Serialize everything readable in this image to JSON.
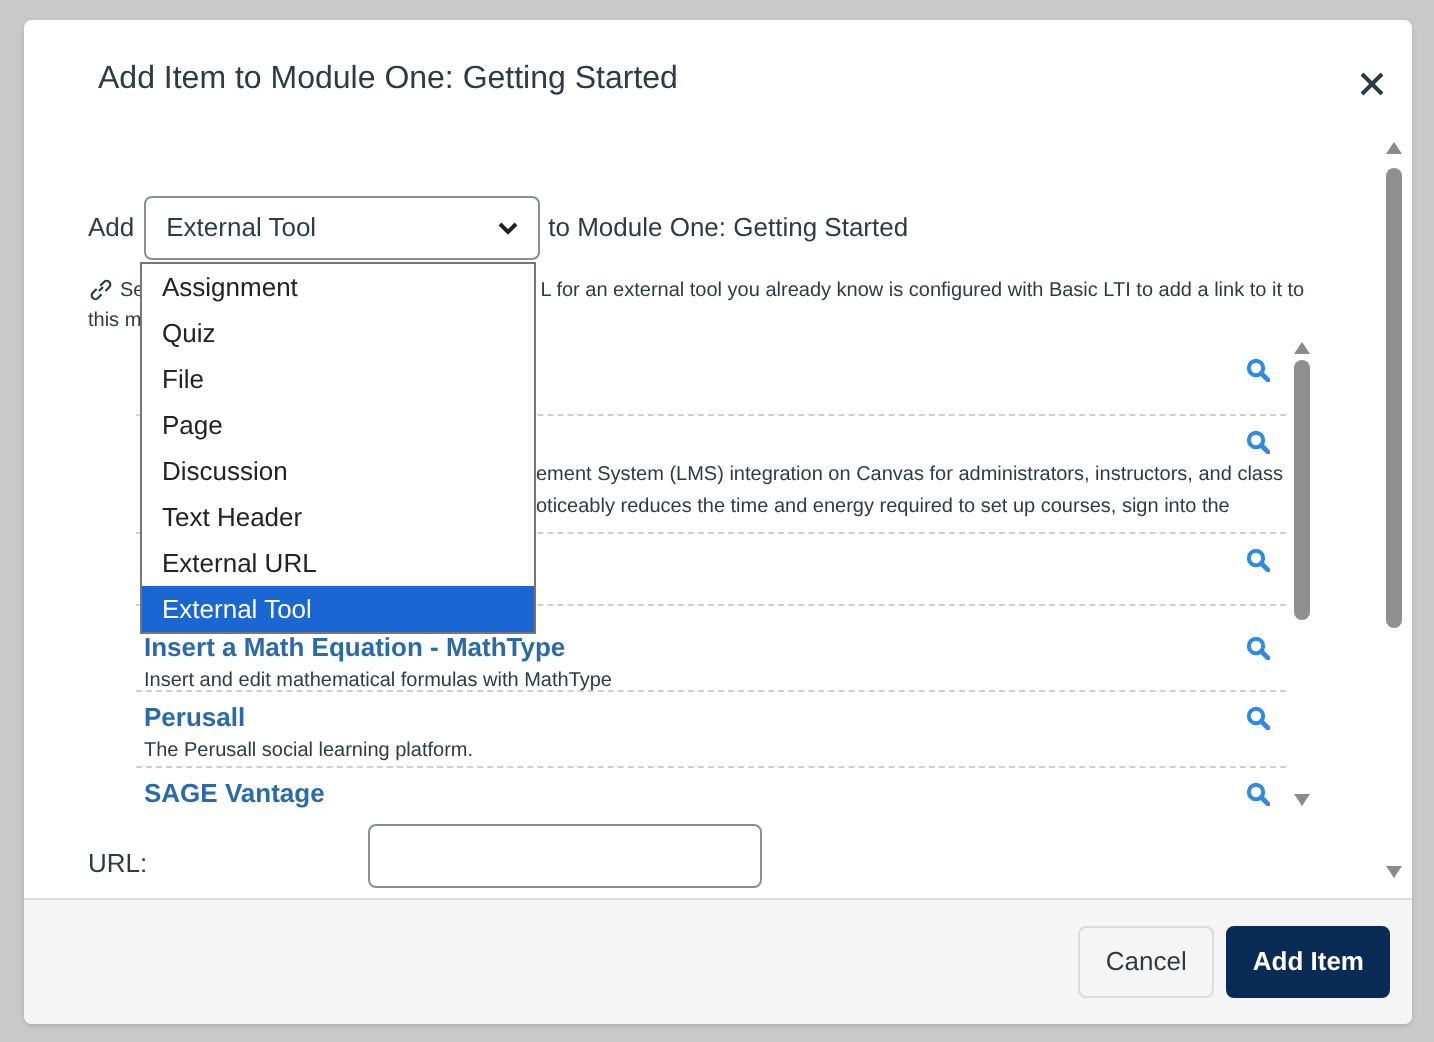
{
  "dialog": {
    "title": "Add Item to Module One: Getting Started"
  },
  "add_row": {
    "label": "Add",
    "select_value": "External Tool",
    "suffix": "to Module One: Getting Started"
  },
  "dropdown": {
    "options": [
      {
        "label": "Assignment",
        "selected": false
      },
      {
        "label": "Quiz",
        "selected": false
      },
      {
        "label": "File",
        "selected": false
      },
      {
        "label": "Page",
        "selected": false
      },
      {
        "label": "Discussion",
        "selected": false
      },
      {
        "label": "Text Header",
        "selected": false
      },
      {
        "label": "External URL",
        "selected": false
      },
      {
        "label": "External Tool",
        "selected": true
      }
    ]
  },
  "intro": {
    "fragments": [
      "Se",
      "L for an external tool you already know is configured with Basic LTI to add a link to it to",
      "this m"
    ]
  },
  "tools": [
    {
      "kind": "covered"
    },
    {
      "kind": "covered",
      "description": [
        "ement System (LMS) integration on Canvas for administrators, instructors, and class",
        "oticeably reduces the time and energy required to set up courses, sign into the"
      ]
    },
    {
      "kind": "covered"
    },
    {
      "kind": "listed",
      "name": "Insert a Math Equation - MathType",
      "description": [
        "Insert and edit mathematical formulas with MathType"
      ]
    },
    {
      "kind": "listed",
      "name": "Perusall",
      "description": [
        "The Perusall social learning platform."
      ]
    },
    {
      "kind": "listed",
      "name": "SAGE Vantage"
    }
  ],
  "url_field": {
    "label": "URL:"
  },
  "buttons": [
    {
      "label": "Cancel",
      "kind": "secondary"
    },
    {
      "label": "Add Item",
      "kind": "primary"
    }
  ]
}
